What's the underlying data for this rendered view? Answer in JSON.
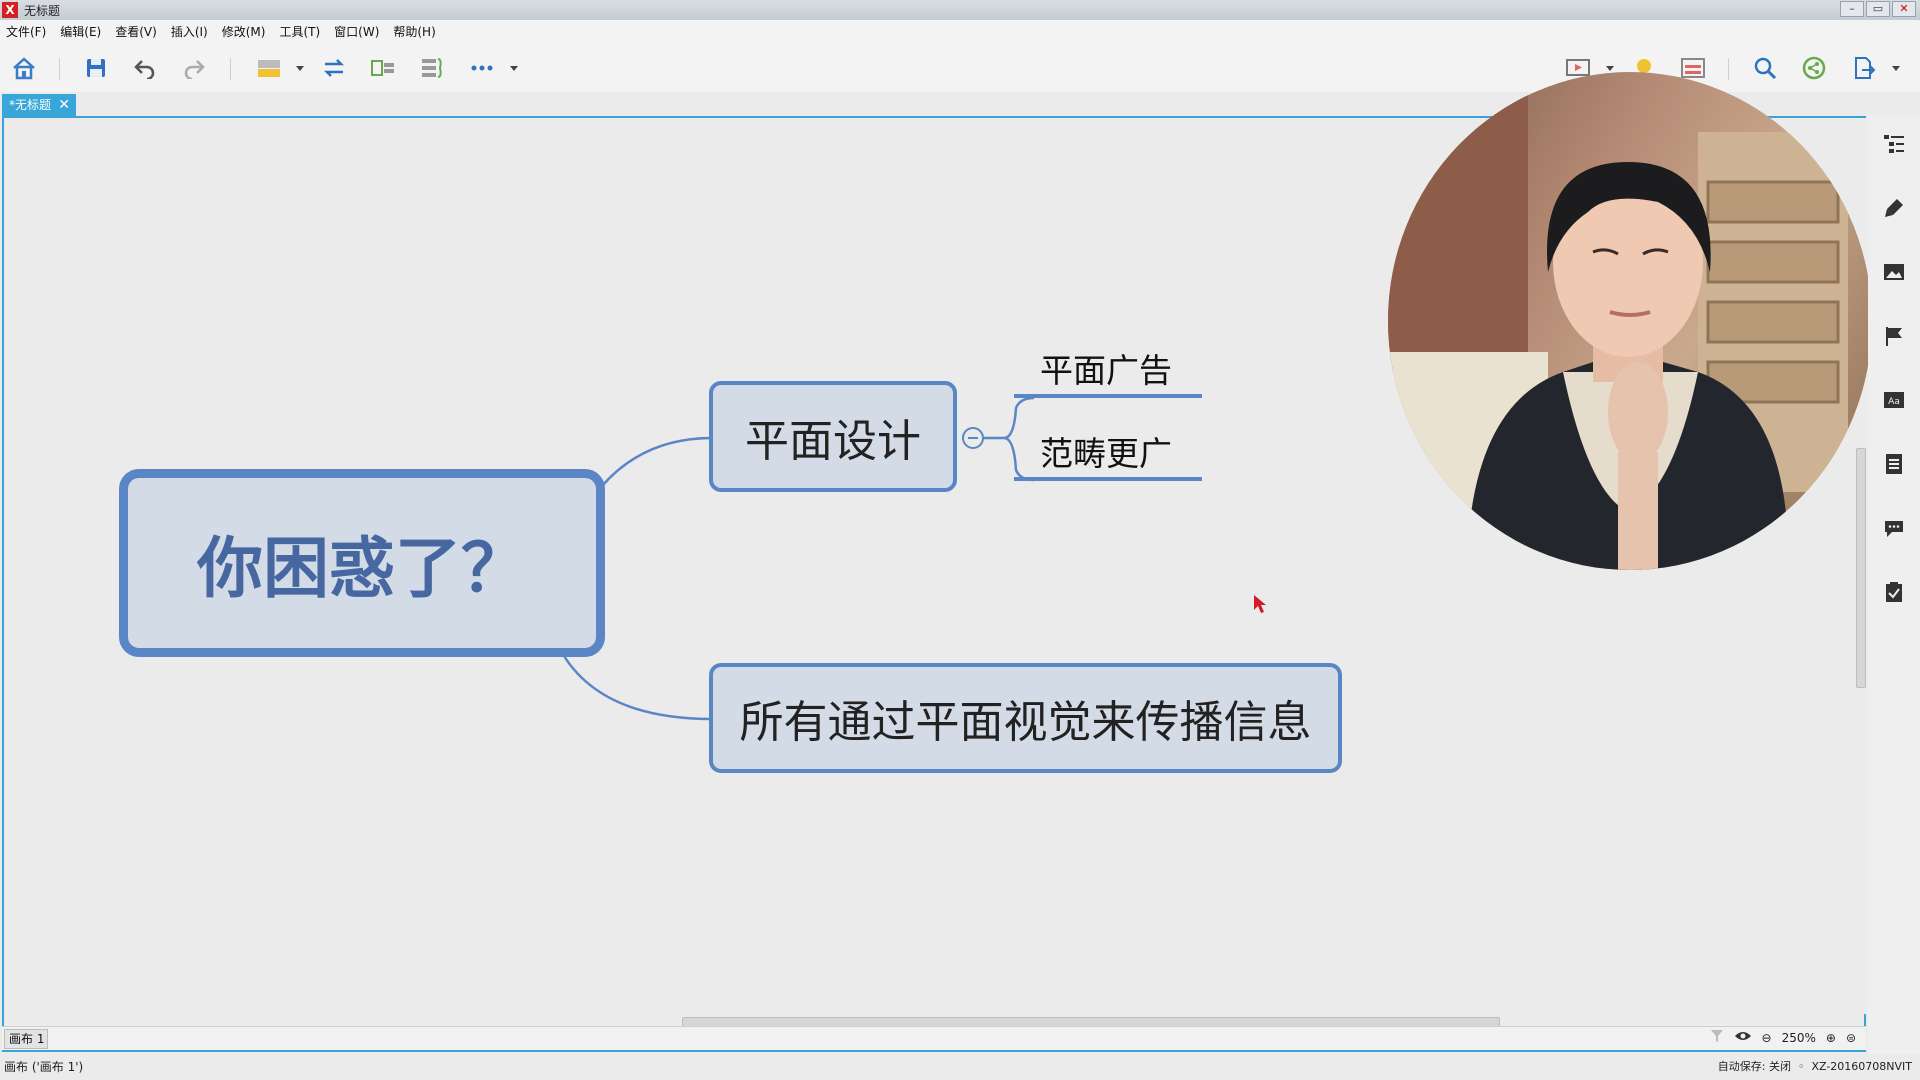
{
  "window": {
    "title": "无标题",
    "logo": "X",
    "controls": [
      "minimize-icon",
      "maximize-icon",
      "close-icon"
    ]
  },
  "menu": [
    "文件(F)",
    "编辑(E)",
    "查看(V)",
    "插入(I)",
    "修改(M)",
    "工具(T)",
    "窗口(W)",
    "帮助(H)"
  ],
  "toolbar": {
    "left_icons": [
      "home-icon",
      "save-icon",
      "undo-icon",
      "redo-icon",
      "topic-icon",
      "relationship-icon",
      "summary-icon",
      "boundary-icon",
      "more-icon"
    ],
    "right_icons": [
      "presentation-icon",
      "light-bulb-icon",
      "layout-icon",
      "search-icon",
      "share-icon",
      "export-icon"
    ]
  },
  "tab": {
    "label": "*无标题",
    "close": "✕"
  },
  "mindmap": {
    "root": "你困惑了？",
    "branch_a": "平面设计",
    "branch_a_children": [
      "平面广告",
      "范畴更广"
    ],
    "branch_b": "所有通过平面视觉来传播信息"
  },
  "canvas_tab": "画布 1",
  "zoom": "250%",
  "status": {
    "left": "画布 ('画布 1')",
    "autosave": "自动保存: 关闭",
    "machine": "XZ-20160708NVIT"
  },
  "right_panel_icons": [
    "outline-icon",
    "format-icon",
    "image-icon",
    "marker-icon",
    "text-icon",
    "notes-icon",
    "comment-icon",
    "task-icon"
  ],
  "colors": {
    "accent": "#3aa2d4",
    "node_border": "#5b86c5",
    "node_fill": "#d3dbe6",
    "root_text": "#4667a0"
  }
}
